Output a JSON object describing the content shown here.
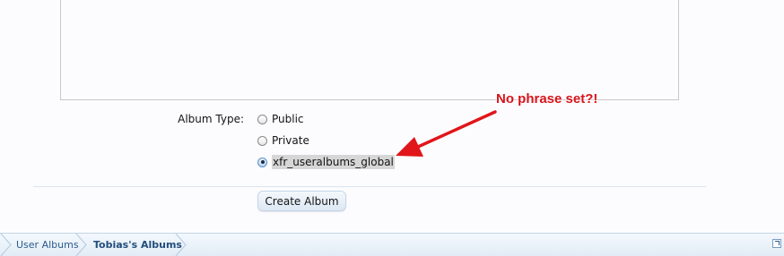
{
  "form": {
    "album_type_label": "Album Type:",
    "options": [
      {
        "label": "Public",
        "checked": false
      },
      {
        "label": "Private",
        "checked": false
      },
      {
        "label": "xfr_useralbums_global",
        "checked": true
      }
    ],
    "create_button_label": "Create Album"
  },
  "breadcrumb": {
    "items": [
      "User Albums",
      "Tobias's Albums"
    ]
  },
  "annotation": {
    "text": "No phrase set?!",
    "color": "#d8141a"
  },
  "icons": {
    "popout": "external-link-icon"
  }
}
